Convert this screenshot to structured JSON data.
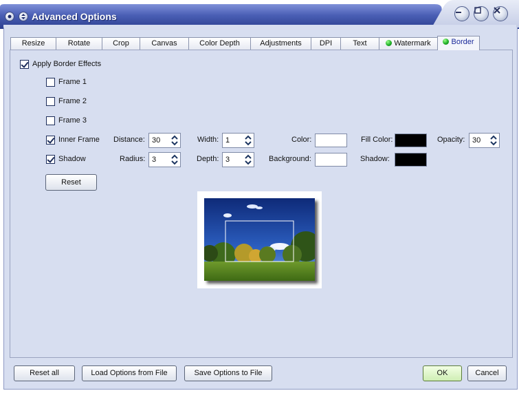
{
  "window": {
    "title": "Advanced Options",
    "controls": [
      "minimize-icon",
      "maximize-icon",
      "close-icon"
    ],
    "accent": "#3b4fa5"
  },
  "tabs": [
    {
      "label": "Resize"
    },
    {
      "label": "Rotate"
    },
    {
      "label": "Crop"
    },
    {
      "label": "Canvas"
    },
    {
      "label": "Color Depth"
    },
    {
      "label": "Adjustments"
    },
    {
      "label": "DPI"
    },
    {
      "label": "Text"
    },
    {
      "label": "Watermark",
      "indicator": "green-dot-icon"
    },
    {
      "label": "Border",
      "indicator": "green-dot-icon",
      "active": true
    }
  ],
  "border": {
    "apply": {
      "label": "Apply Border Effects",
      "checked": true
    },
    "frame1": {
      "label": "Frame 1",
      "checked": false
    },
    "frame2": {
      "label": "Frame 2",
      "checked": false
    },
    "frame3": {
      "label": "Frame 3",
      "checked": false
    },
    "inner_frame": {
      "label": "Inner Frame",
      "checked": true,
      "distance_label": "Distance:",
      "distance": "30",
      "width_label": "Width:",
      "width": "1",
      "color_label": "Color:",
      "color": "#ffffff",
      "fill_label": "Fill Color:",
      "fill": "#000000",
      "opacity_label": "Opacity:",
      "opacity": "30"
    },
    "shadow": {
      "label": "Shadow",
      "checked": true,
      "radius_label": "Radius:",
      "radius": "3",
      "depth_label": "Depth:",
      "depth": "3",
      "background_label": "Background:",
      "background": "#ffffff",
      "shadow_label": "Shadow:",
      "shadow_color": "#000000"
    },
    "reset_label": "Reset"
  },
  "footer": {
    "reset_all": "Reset all",
    "load": "Load Options from File",
    "save": "Save Options to File",
    "ok": "OK",
    "cancel": "Cancel"
  }
}
